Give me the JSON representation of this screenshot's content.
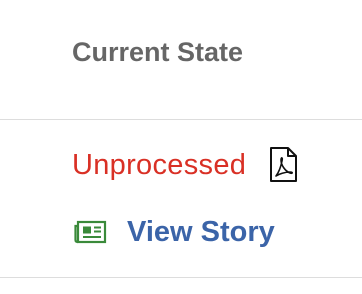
{
  "table": {
    "header": "Current State",
    "row": {
      "state": "Unprocessed",
      "story_link": "View Story"
    }
  },
  "icons": {
    "document": "pdf-icon",
    "story": "newspaper-icon"
  },
  "colors": {
    "header_text": "#666666",
    "state_text": "#d93025",
    "link_text": "#3b64a8",
    "news_icon": "#3a8a3a",
    "divider": "#dddddd"
  }
}
